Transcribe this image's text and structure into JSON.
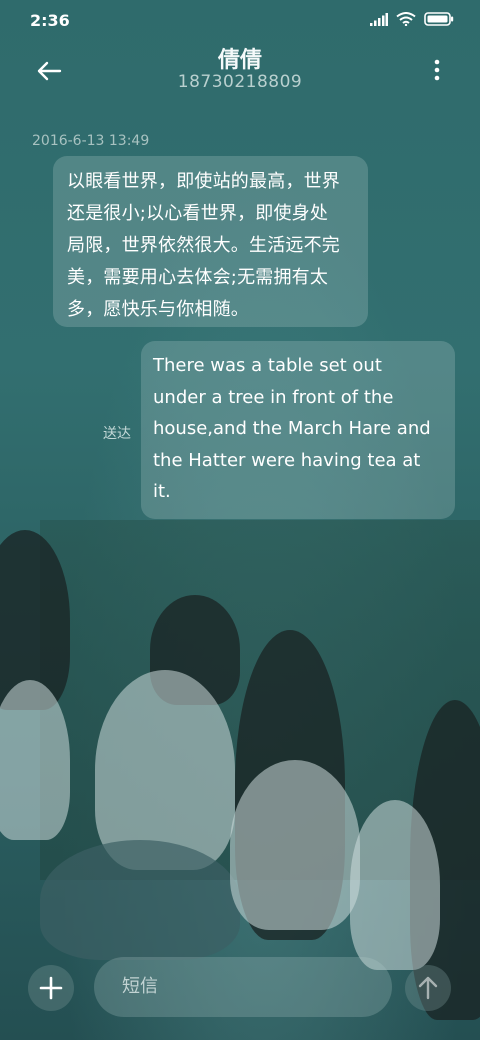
{
  "status_bar": {
    "time": "2:36",
    "icons": [
      "signal-icon",
      "wifi-icon",
      "battery-icon"
    ]
  },
  "header": {
    "title": "倩倩",
    "subtitle": "18730218809",
    "back_icon": "arrow-left-icon",
    "more_icon": "more-vertical-icon"
  },
  "conversation": {
    "timestamp": "2016-6-13 13:49",
    "incoming": {
      "lines": [
        "以眼看世界，即使站的最高，世界",
        "还是很小;以心看世界，即使身处",
        "局限，世界依然很大。生活远不完",
        "美，需要用心去体会;无需拥有太",
        "多，愿快乐与你相随。"
      ]
    },
    "outgoing": {
      "status": "送达",
      "lines": [
        "There was a table set out",
        "under a tree in front of the",
        "house,and the March Hare and",
        "the Hatter were having tea at",
        "it."
      ]
    }
  },
  "compose": {
    "placeholder": "短信",
    "add_icon": "plus-icon",
    "send_icon": "arrow-up-icon"
  },
  "colors": {
    "background": "#2f6b6c",
    "bubble": "#cde1e0",
    "text": "#ffffff"
  }
}
